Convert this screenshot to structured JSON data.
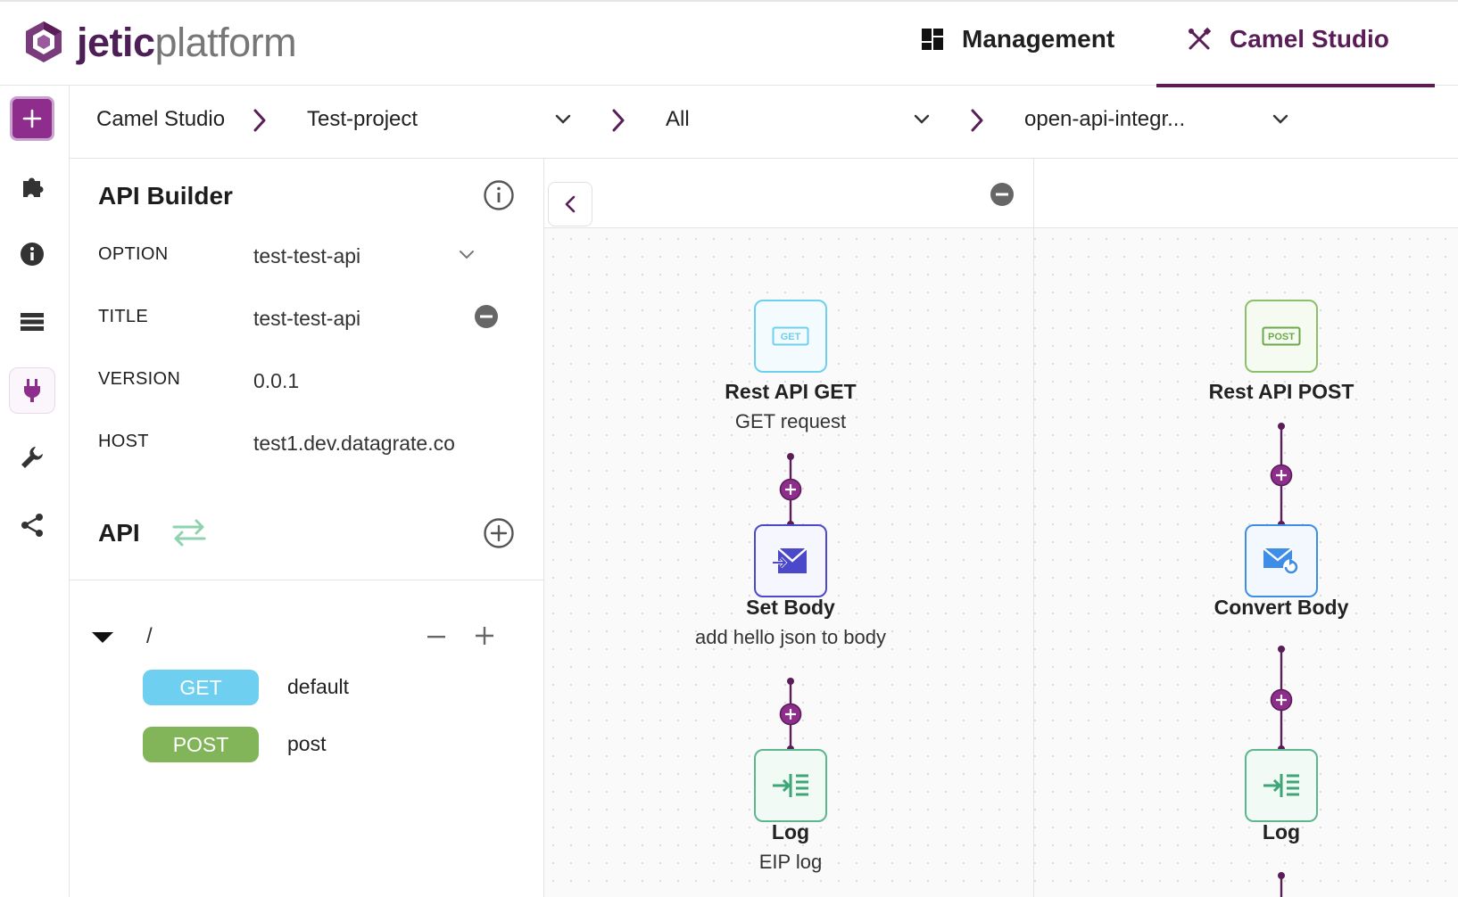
{
  "header": {
    "logo_bold": "jetic",
    "logo_light": "platform",
    "nav": [
      {
        "label": "Management",
        "icon": "dashboard-icon"
      },
      {
        "label": "Camel Studio",
        "icon": "tools-icon",
        "active": true
      }
    ]
  },
  "sidebar": {
    "items": [
      "add-icon",
      "puzzle-icon",
      "info-icon",
      "list-icon",
      "plug-icon",
      "wrench-icon",
      "share-icon"
    ],
    "active": "plug-icon"
  },
  "breadcrumb": {
    "root": "Camel Studio",
    "project": "Test-project",
    "filter": "All",
    "integration": "open-api-integr..."
  },
  "api_builder": {
    "title": "API Builder",
    "fields": [
      {
        "label": "OPTION",
        "value": "test-test-api"
      },
      {
        "label": "TITLE",
        "value": "test-test-api"
      },
      {
        "label": "VERSION",
        "value": "0.0.1"
      },
      {
        "label": "HOST",
        "value": "test1.dev.datagrate.co"
      }
    ],
    "api_title": "API",
    "path": "/",
    "methods": [
      {
        "method": "GET",
        "name": "default",
        "color": "#6fcff0"
      },
      {
        "method": "POST",
        "name": "post",
        "color": "#82b55a"
      }
    ]
  },
  "flows": {
    "left": [
      {
        "badge": "GET",
        "title": "Rest API GET",
        "subtitle": "GET request"
      },
      {
        "title": "Set Body",
        "subtitle": "add hello json to body"
      },
      {
        "title": "Log",
        "subtitle": "EIP log"
      }
    ],
    "right": [
      {
        "badge": "POST",
        "title": "Rest API POST",
        "subtitle": ""
      },
      {
        "title": "Convert Body",
        "subtitle": ""
      },
      {
        "title": "Log",
        "subtitle": ""
      }
    ]
  },
  "colors": {
    "brand": "#5a1d57",
    "accent": "#8e2d8c",
    "get": "#6fcff0",
    "post": "#82b55a"
  }
}
